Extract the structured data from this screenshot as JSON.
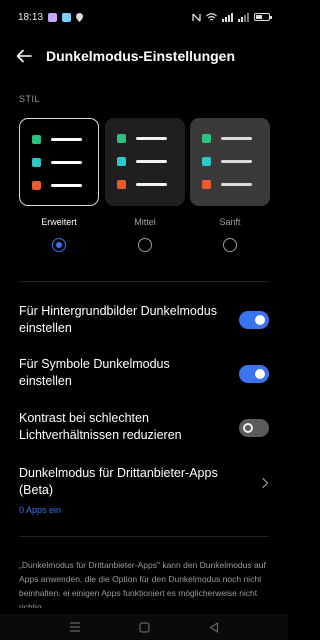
{
  "status_bar": {
    "time": "18:13"
  },
  "header": {
    "title": "Dunkelmodus-Einstellungen"
  },
  "style_section": {
    "label": "STIL",
    "options": [
      {
        "label": "Erweitert",
        "selected": true
      },
      {
        "label": "Mittel",
        "selected": false
      },
      {
        "label": "Sanft",
        "selected": false
      }
    ]
  },
  "settings": {
    "wallpaper": {
      "label": "Für Hintergrundbilder Dunkelmodus einstellen",
      "enabled": true
    },
    "icons": {
      "label": "Für Symbole Dunkelmodus einstellen",
      "enabled": true
    },
    "contrast": {
      "label": "Kontrast bei schlechten Lichtverhältnissen reduzieren",
      "enabled": false
    },
    "third_party": {
      "label": "Dunkelmodus für Drittanbieter-Apps (Beta)",
      "subtext": "0 Apps ein"
    }
  },
  "footer_note": "„Dunkelmodus für Drittanbieter-Apps\" kann den Dunkelmodus auf Apps anwenden, die die Option für den Dunkelmodus noch nicht beinhalten. ei einigen Apps funktioniert es möglicherweise nicht richtig.",
  "colors": {
    "accent": "#3b73f0",
    "green": "#2ec27e",
    "cyan": "#2ec8c8",
    "orange": "#ea5a2e"
  }
}
